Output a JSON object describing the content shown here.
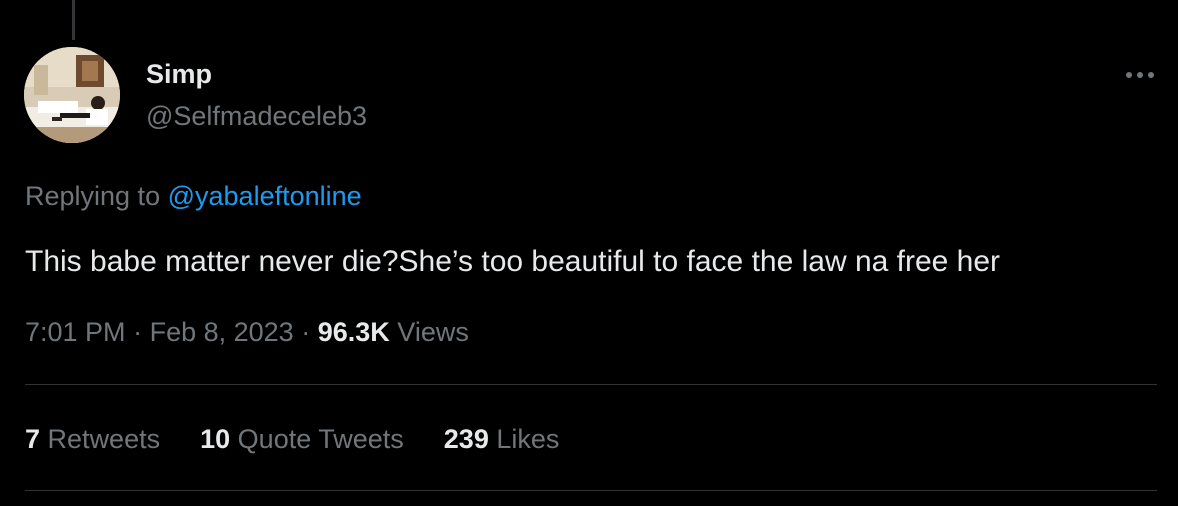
{
  "tweet": {
    "author_name": "Simp",
    "author_handle": "@Selfmadeceleb3",
    "replying_prefix": "Replying to",
    "replying_to": "@yabaleftonline",
    "text": "This babe matter never die?She’s too beautiful to face the law na free her",
    "time": "7:01 PM",
    "date": "Feb 8, 2023",
    "views_count": "96.3K",
    "views_label": "Views",
    "more_icon": "ellipsis-icon"
  },
  "stats": {
    "retweets_count": "7",
    "retweets_label": "Retweets",
    "quotes_count": "10",
    "quotes_label": "Quote Tweets",
    "likes_count": "239",
    "likes_label": "Likes"
  },
  "colors": {
    "background": "#000000",
    "primary_text": "#e7e9ea",
    "secondary_text": "#71767b",
    "link": "#1d9bf0",
    "divider": "#2f3336"
  }
}
